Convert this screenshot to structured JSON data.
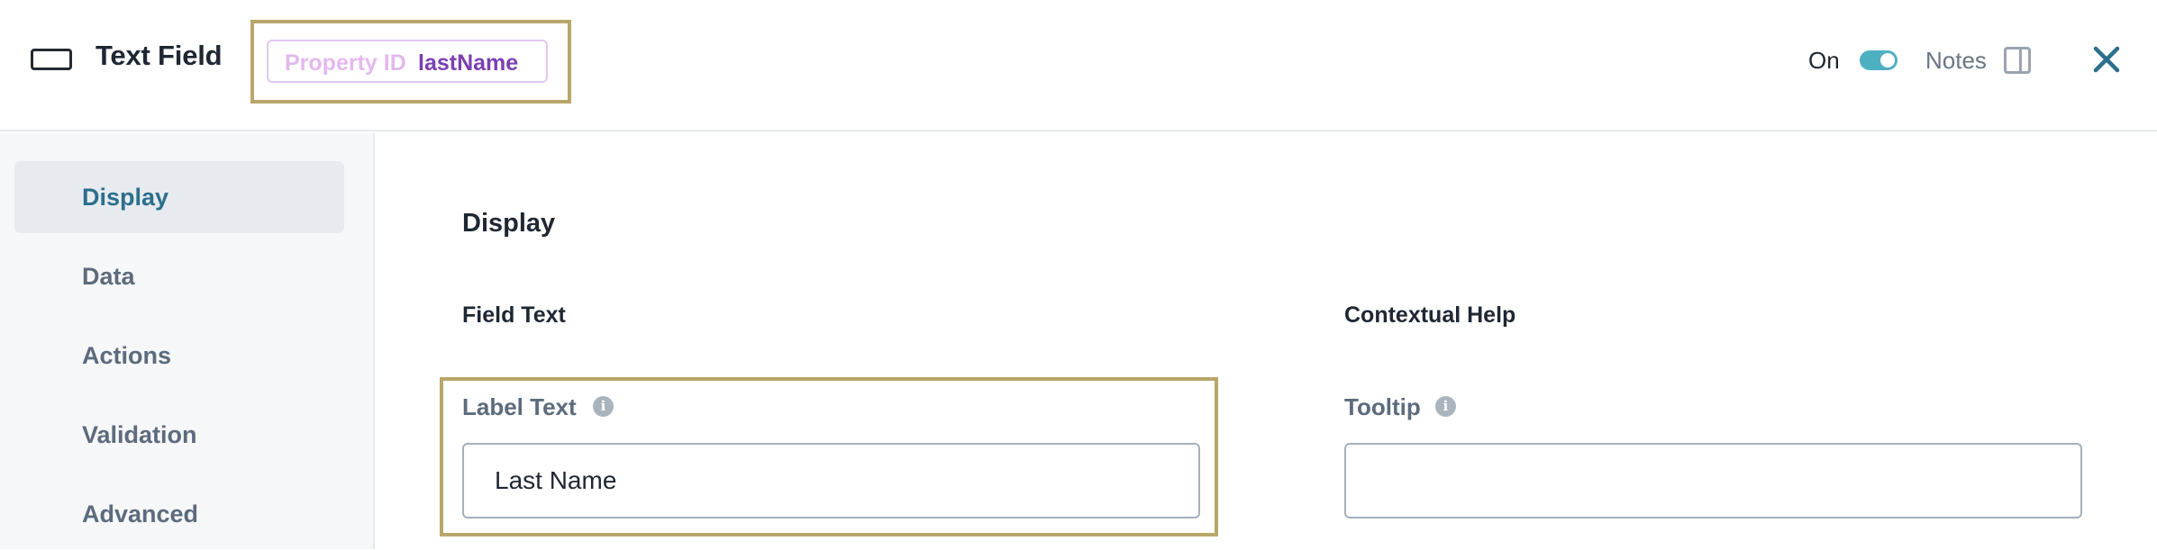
{
  "header": {
    "title": "Text Field",
    "property_id_label": "Property ID",
    "property_id_value": "lastName",
    "on_label": "On",
    "notes_label": "Notes"
  },
  "sidebar": {
    "items": [
      {
        "label": "Display",
        "active": true
      },
      {
        "label": "Data",
        "active": false
      },
      {
        "label": "Actions",
        "active": false
      },
      {
        "label": "Validation",
        "active": false
      },
      {
        "label": "Advanced",
        "active": false
      }
    ]
  },
  "main": {
    "section_title": "Display",
    "field_text": {
      "group_title": "Field Text",
      "label_text_label": "Label Text",
      "label_text_value": "Last Name"
    },
    "contextual_help": {
      "group_title": "Contextual Help",
      "tooltip_label": "Tooltip",
      "tooltip_value": ""
    }
  },
  "colors": {
    "accent": "#4db0c0",
    "highlight_border": "#b9a66a",
    "property_id_value": "#7a3fb2",
    "active_nav_text": "#2b6f8c"
  },
  "icons": {
    "field_type": "text-field-icon",
    "notes": "notes-panel-icon",
    "close": "close-icon",
    "info": "info-icon"
  }
}
